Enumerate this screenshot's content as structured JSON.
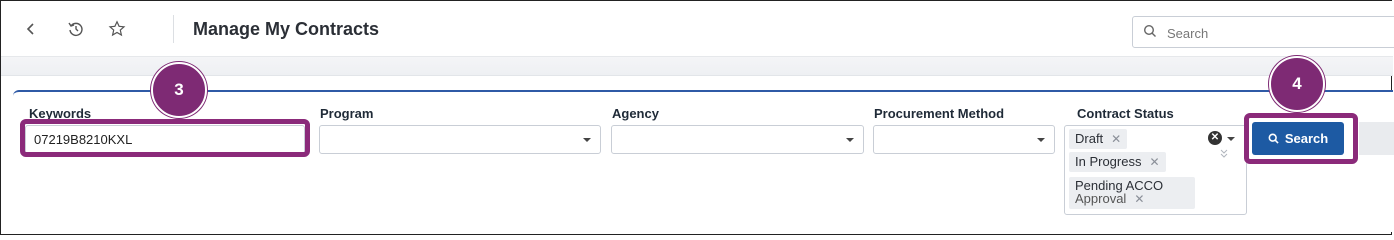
{
  "header": {
    "back_icon": "chevron-left-icon",
    "history_icon": "history-icon",
    "favorite_icon": "star-icon",
    "title": "Manage My Contracts",
    "search_placeholder": "Search"
  },
  "filters": {
    "keywords_label": "Keywords",
    "keywords_value": "07219B8210KXL",
    "program_label": "Program",
    "agency_label": "Agency",
    "procurement_label": "Procurement Method",
    "status_label": "Contract Status",
    "status_chips": [
      {
        "label": "Draft"
      },
      {
        "label": "In Progress"
      },
      {
        "label_line1": "Pending ACCO",
        "label_line2": "Approval"
      }
    ],
    "chip_remove_glyph": "✕",
    "search_button_label": "Search"
  },
  "callouts": {
    "keywords_step": "3",
    "search_step": "4"
  },
  "colors": {
    "accent_blue": "#1d5aa3",
    "highlight_purple": "#8b2a7a",
    "panel_border_blue": "#2f5aa6"
  }
}
